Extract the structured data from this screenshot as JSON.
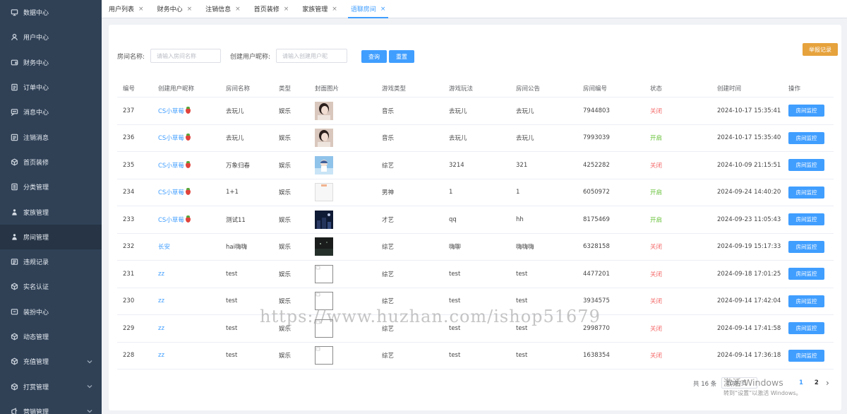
{
  "sidebar": {
    "items": [
      {
        "label": "数据中心",
        "icon": "monitor-icon",
        "has_children": false
      },
      {
        "label": "用户中心",
        "icon": "user-icon",
        "has_children": false
      },
      {
        "label": "财务中心",
        "icon": "wallet-icon",
        "has_children": false
      },
      {
        "label": "订单中心",
        "icon": "order-icon",
        "has_children": false
      },
      {
        "label": "消息中心",
        "icon": "message-icon",
        "has_children": false
      },
      {
        "label": "注销消息",
        "icon": "logout-icon",
        "has_children": false
      },
      {
        "label": "首页装修",
        "icon": "cube-icon",
        "has_children": false
      },
      {
        "label": "分类管理",
        "icon": "category-icon",
        "has_children": false
      },
      {
        "label": "家族管理",
        "icon": "family-icon",
        "has_children": false
      },
      {
        "label": "房间管理",
        "icon": "room-icon",
        "has_children": false,
        "active": true
      },
      {
        "label": "违规记录",
        "icon": "record-icon",
        "has_children": false
      },
      {
        "label": "实名认证",
        "icon": "verify-icon",
        "has_children": false
      },
      {
        "label": "装扮中心",
        "icon": "dress-icon",
        "has_children": false
      },
      {
        "label": "动态管理",
        "icon": "feed-icon",
        "has_children": false
      },
      {
        "label": "充值管理",
        "icon": "recharge-icon",
        "has_children": true
      },
      {
        "label": "打赏管理",
        "icon": "reward-icon",
        "has_children": true
      },
      {
        "label": "营销管理",
        "icon": "marketing-icon",
        "has_children": true
      }
    ]
  },
  "tabs": [
    {
      "label": "用户列表",
      "active": false
    },
    {
      "label": "财务中心",
      "active": false
    },
    {
      "label": "注销信息",
      "active": false
    },
    {
      "label": "首页装修",
      "active": false
    },
    {
      "label": "家族管理",
      "active": false
    },
    {
      "label": "语聊房间",
      "active": true
    }
  ],
  "tab_close_glyph": "×",
  "toolbar": {
    "report_label": "举报记录"
  },
  "filters": {
    "room_name_label": "房间名称:",
    "room_name_placeholder": "请输入房间名称",
    "creator_label": "创建用户昵称:",
    "creator_placeholder": "请输入创建用户昵",
    "search_label": "查询",
    "reset_label": "重置"
  },
  "table": {
    "columns": [
      "编号",
      "创建用户昵称",
      "房间名称",
      "类型",
      "封面图片",
      "游戏类型",
      "游戏玩法",
      "房间公告",
      "房间编号",
      "状态",
      "创建时间",
      "操作"
    ],
    "action_label": "房间监控",
    "rows": [
      {
        "id": "237",
        "creator": "CS小草莓",
        "berry": true,
        "room": "去玩儿",
        "type": "娱乐",
        "cover": "portrait",
        "game_type": "音乐",
        "play": "去玩儿",
        "notice": "去玩儿",
        "room_no": "7944803",
        "status": "关闭",
        "created": "2024-10-17 15:35:41"
      },
      {
        "id": "236",
        "creator": "CS小草莓",
        "berry": true,
        "room": "去玩儿",
        "type": "娱乐",
        "cover": "portrait",
        "game_type": "音乐",
        "play": "去玩儿",
        "notice": "去玩儿",
        "room_no": "7993039",
        "status": "开启",
        "created": "2024-10-17 15:35:40"
      },
      {
        "id": "235",
        "creator": "CS小草莓",
        "berry": true,
        "room": "万象归春",
        "type": "娱乐",
        "cover": "anime",
        "game_type": "综艺",
        "play": "3214",
        "notice": "321",
        "room_no": "4252282",
        "status": "关闭",
        "created": "2024-10-09 21:15:51"
      },
      {
        "id": "234",
        "creator": "CS小草莓",
        "berry": true,
        "room": "1+1",
        "type": "娱乐",
        "cover": "blank",
        "game_type": "男神",
        "play": "1",
        "notice": "1",
        "room_no": "6050972",
        "status": "开启",
        "created": "2024-09-24 14:40:20"
      },
      {
        "id": "233",
        "creator": "CS小草莓",
        "berry": true,
        "room": "测试11",
        "type": "娱乐",
        "cover": "night",
        "game_type": "才艺",
        "play": "qq",
        "notice": "hh",
        "room_no": "8175469",
        "status": "开启",
        "created": "2024-09-23 11:05:43"
      },
      {
        "id": "232",
        "creator": "长安",
        "berry": false,
        "room": "hai嗨嗨",
        "type": "娱乐",
        "cover": "dark",
        "game_type": "综艺",
        "play": "嗨聊",
        "notice": "嗨嗨嗨",
        "room_no": "6328158",
        "status": "关闭",
        "created": "2024-09-19 15:17:33"
      },
      {
        "id": "231",
        "creator": "zz",
        "berry": false,
        "room": "test",
        "type": "娱乐",
        "cover": "broken",
        "game_type": "综艺",
        "play": "test",
        "notice": "test",
        "room_no": "4477201",
        "status": "关闭",
        "created": "2024-09-18 17:01:25"
      },
      {
        "id": "230",
        "creator": "zz",
        "berry": false,
        "room": "test",
        "type": "娱乐",
        "cover": "broken",
        "game_type": "综艺",
        "play": "test",
        "notice": "test",
        "room_no": "3934575",
        "status": "关闭",
        "created": "2024-09-14 17:42:04"
      },
      {
        "id": "229",
        "creator": "zz",
        "berry": false,
        "room": "test",
        "type": "娱乐",
        "cover": "broken",
        "game_type": "综艺",
        "play": "test",
        "notice": "test",
        "room_no": "2998770",
        "status": "关闭",
        "created": "2024-09-14 17:41:58"
      },
      {
        "id": "228",
        "creator": "zz",
        "berry": false,
        "room": "test",
        "type": "娱乐",
        "cover": "broken",
        "game_type": "综艺",
        "play": "test",
        "notice": "test",
        "room_no": "1638354",
        "status": "关闭",
        "created": "2024-09-14 17:36:18"
      }
    ]
  },
  "pagination": {
    "total": "共 16 条",
    "page_size": "10条/页",
    "pages": [
      "1",
      "2"
    ],
    "current": "1",
    "next_glyph": "›"
  },
  "overlays": {
    "watermark": "https://www.huzhan.com/ishop51679",
    "activate_title": "激活 Windows",
    "activate_sub": "转到“设置”以激活 Windows。"
  },
  "colors": {
    "sidebar_bg": "#304156",
    "primary": "#409eff",
    "warning": "#e6a23c",
    "closed": "#f56c6c",
    "open": "#67c23a"
  }
}
